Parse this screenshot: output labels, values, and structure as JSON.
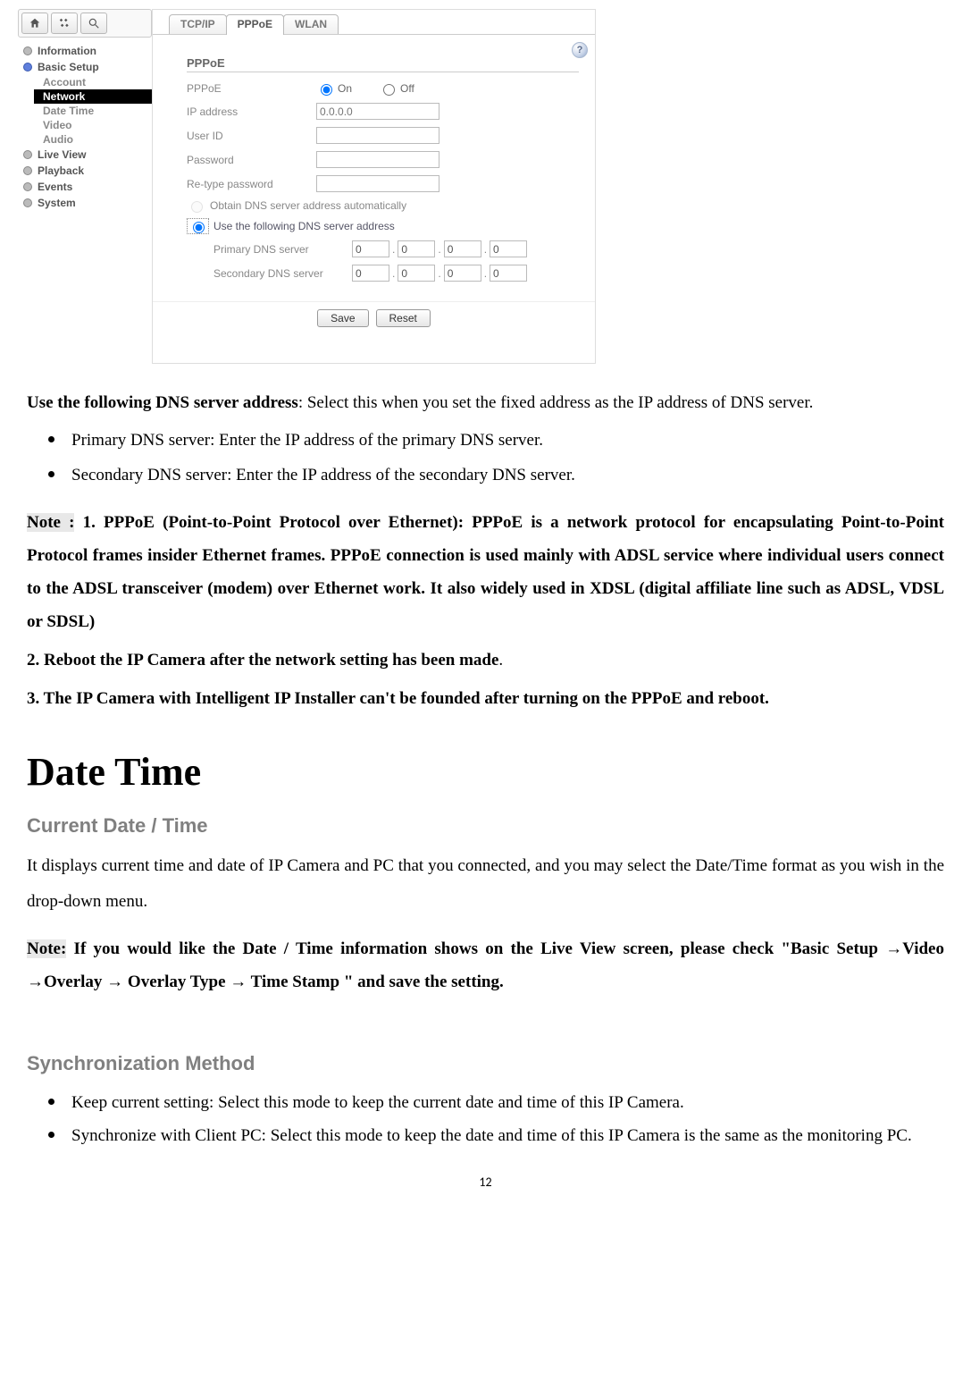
{
  "ui": {
    "sidebar": {
      "items": [
        {
          "label": "Information",
          "selected": false
        },
        {
          "label": "Basic Setup",
          "selected": true
        }
      ],
      "subs": [
        "Account",
        "Network",
        "Date Time",
        "Video",
        "Audio"
      ],
      "activeSub": "Network",
      "tail": [
        {
          "label": "Live View"
        },
        {
          "label": "Playback"
        },
        {
          "label": "Events"
        },
        {
          "label": "System"
        }
      ]
    },
    "tabs": [
      "TCP/IP",
      "PPPoE",
      "WLAN"
    ],
    "activeTab": "PPPoE",
    "help": "?",
    "section": "PPPoE",
    "rows": {
      "pppoe_label": "PPPoE",
      "on": "On",
      "off": "Off",
      "ip_label": "IP address",
      "ip_ph": "0.0.0.0",
      "user_label": "User ID",
      "pwd_label": "Password",
      "repwd_label": "Re-type password"
    },
    "dns": {
      "auto": "Obtain DNS server address automatically",
      "manual": "Use the following DNS server address",
      "primary": "Primary DNS server",
      "secondary": "Secondary DNS server",
      "oct": "0",
      "dot": "."
    },
    "buttons": {
      "save": "Save",
      "reset": "Reset"
    }
  },
  "doc": {
    "para1_bold": "Use the following DNS server address",
    "para1_rest": ": Select this when you set the fixed address as the IP address of DNS server.",
    "bullets": [
      "Primary DNS server: Enter the IP address of the primary DNS server.",
      "Secondary DNS server: Enter the IP address of the secondary DNS server."
    ],
    "note_label": "Note :",
    "note1": " 1. PPPoE (Point-to-Point Protocol over Ethernet): PPPoE is a network protocol for encapsulating Point-to-Point Protocol frames insider Ethernet frames. PPPoE connection is used mainly with ADSL service where individual users connect to the ADSL transceiver (modem) over Ethernet work. It also widely used in XDSL (digital affiliate line such as ADSL, VDSL or SDSL)",
    "note2": "2. Reboot the IP Camera after the network setting has been made",
    "note2_tail": ".",
    "note3": "3. The IP Camera with Intelligent IP Installer can't be founded after turning on the PPPoE and reboot.",
    "h1": "Date Time",
    "h2a": "Current Date / Time",
    "p2": "It displays current time and date of IP Camera and PC that you connected, and you may select the Date/Time format as you wish in the drop-down menu.",
    "note2_label": "Note:",
    "note2_text": " If you would like the Date / Time information shows on the Live View screen, please check \"Basic Setup →Video →Overlay → Overlay Type → Time Stamp \" and save the setting.",
    "h2b": "Synchronization Method",
    "sync": [
      {
        "b": "Keep current setting:",
        "t": " Select this mode to keep the current date and time of this IP Camera."
      },
      {
        "b": "Synchronize with Client PC:",
        "t": " Select this mode to keep the date and time of this IP Camera is the same as the monitoring PC."
      }
    ],
    "pagenum": "12"
  }
}
